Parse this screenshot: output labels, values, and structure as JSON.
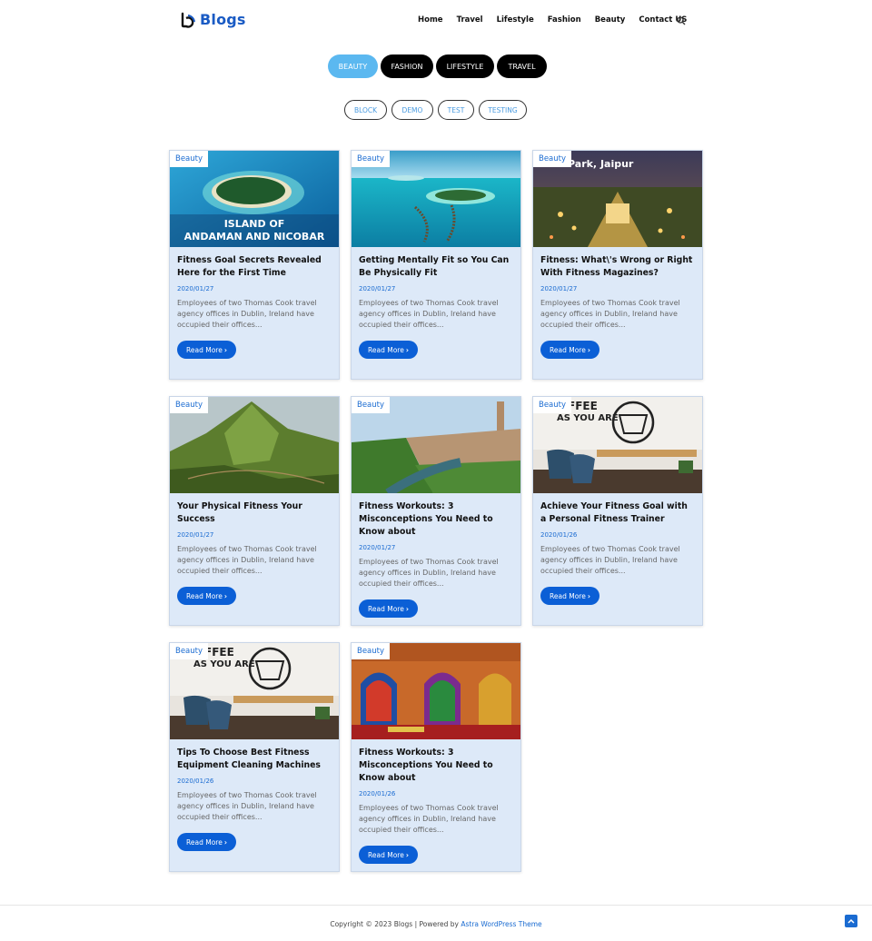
{
  "header": {
    "logo_text": "Blogs",
    "nav": [
      "Home",
      "Travel",
      "Lifestyle",
      "Fashion",
      "Beauty",
      "Contact US"
    ]
  },
  "category_tabs": [
    "BEAUTY",
    "FASHION",
    "LIFESTYLE",
    "TRAVEL"
  ],
  "tag_tabs": [
    "BLOCK",
    "DEMO",
    "TEST",
    "TESTING"
  ],
  "posts": [
    {
      "badge": "Beauty",
      "image": "island-andaman",
      "image_caption": "ISLAND OF ANDAMAN AND NICOBAR",
      "title": "Fitness Goal Secrets Revealed Here for the First Time",
      "date": "2020/01/27",
      "excerpt": "Employees of two Thomas Cook travel agency offices in Dublin, Ireland have occupied their offices...",
      "button": "Read More"
    },
    {
      "badge": "Beauty",
      "image": "maldives-resort",
      "image_caption": "",
      "title": "Getting Mentally Fit so You Can Be Physically Fit",
      "date": "2020/01/27",
      "excerpt": "Employees of two Thomas Cook travel agency offices in Dublin, Ireland have occupied their offices...",
      "button": "Read More"
    },
    {
      "badge": "Beauty",
      "image": "jaipur-park",
      "image_caption": "Park, Jaipur",
      "title": "Fitness: What\\'s Wrong or Right With Fitness Magazines?",
      "date": "2020/01/27",
      "excerpt": "Employees of two Thomas Cook travel agency offices in Dublin, Ireland have occupied their offices...",
      "button": "Read More"
    },
    {
      "badge": "Beauty",
      "image": "green-hill-fort",
      "image_caption": "",
      "title": "Your Physical Fitness Your Success",
      "date": "2020/01/27",
      "excerpt": "Employees of two Thomas Cook travel agency offices in Dublin, Ireland have occupied their offices...",
      "button": "Read More"
    },
    {
      "badge": "Beauty",
      "image": "chittorgarh-fort",
      "image_caption": "",
      "title": "Fitness Workouts: 3 Misconceptions You Need to Know about",
      "date": "2020/01/27",
      "excerpt": "Employees of two Thomas Cook travel agency offices in Dublin, Ireland have occupied their offices...",
      "button": "Read More"
    },
    {
      "badge": "Beauty",
      "image": "coffee-shop",
      "image_caption": "FFEE AS YOU ARE",
      "title": "Achieve Your Fitness Goal with a Personal Fitness Trainer",
      "date": "2020/01/26",
      "excerpt": "Employees of two Thomas Cook travel agency offices in Dublin, Ireland have occupied their offices...",
      "button": "Read More"
    },
    {
      "badge": "Beauty",
      "image": "coffee-shop",
      "image_caption": "FFEE AS YOU ARE",
      "title": "Tips To Choose Best Fitness Equipment Cleaning Machines",
      "date": "2020/01/26",
      "excerpt": "Employees of two Thomas Cook travel agency offices in Dublin, Ireland have occupied their offices...",
      "button": "Read More"
    },
    {
      "badge": "Beauty",
      "image": "palace-interior",
      "image_caption": "",
      "title": "Fitness Workouts: 3 Misconceptions You Need to Know about",
      "date": "2020/01/26",
      "excerpt": "Employees of two Thomas Cook travel agency offices in Dublin, Ireland have occupied their offices...",
      "button": "Read More"
    }
  ],
  "footer": {
    "copyright": "Copyright © 2023 Blogs | Powered by ",
    "theme_link": "Astra WordPress Theme"
  },
  "colors": {
    "accent": "#0b5fd6",
    "active_tab": "#5bb8f0",
    "card_bg": "#dde9f8"
  }
}
